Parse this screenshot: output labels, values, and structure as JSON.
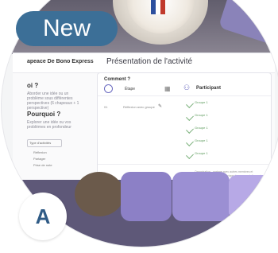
{
  "badge_new": "New",
  "badge_letter": "A",
  "header": {
    "brand": "apeace De Bono Express",
    "title": "Présentation de l'activité"
  },
  "left_panel": {
    "h1": "oi ?",
    "t1": "Aborder une idée ou un problème sous différentes perspectives (6 chapeaux + 1 perspective)",
    "h2": "Pourquoi ?",
    "t2": "Explorer une idée ou vos problèmes en profondeur",
    "pill": "Type d'activités",
    "list1": "Réflexion",
    "list2": "Partager",
    "list3": "Prise de note"
  },
  "card": {
    "comment": "Comment ?",
    "etape": "Étape",
    "participant": "Participant",
    "row1": "Réflexion avec groupe",
    "row2": "Réflexion",
    "groupe": "Groupe 1",
    "bottom_text": "Organisation - partage avec autres membres et commentaires après un partage de groupe et discussion"
  },
  "colors": {
    "accent": "#3c6f97",
    "purple": "#8c80c6"
  }
}
